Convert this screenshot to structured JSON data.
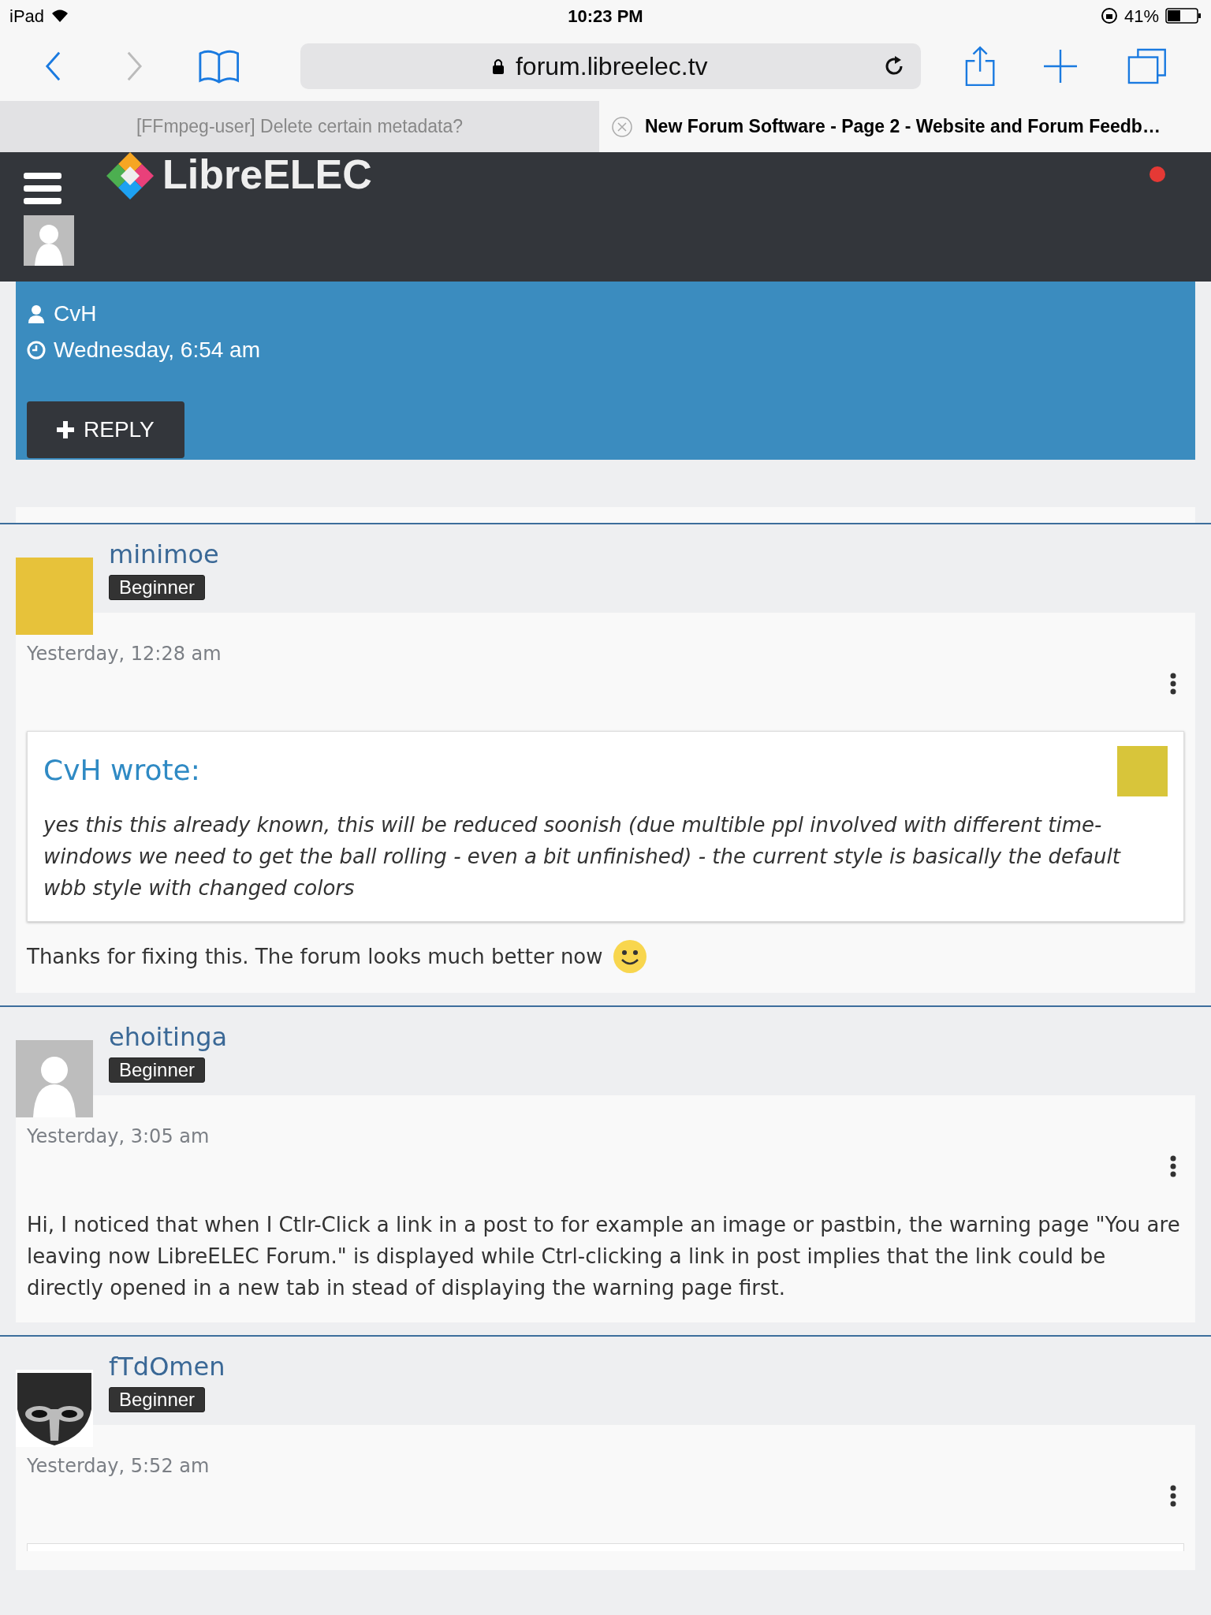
{
  "status_bar": {
    "device": "iPad",
    "time": "10:23 PM",
    "battery": "41%"
  },
  "browser": {
    "url": "forum.libreelec.tv",
    "tabs": [
      {
        "title": "[FFmpeg-user] Delete certain metadata?",
        "selected": false
      },
      {
        "title": "New Forum Software - Page 2 - Website and Forum Feedb…",
        "selected": true
      }
    ]
  },
  "site_header": {
    "logo": "LibreELEC",
    "notification": true
  },
  "thread": {
    "author": "CvH",
    "date": "Wednesday, 6:54 am",
    "reply_button": "REPLY"
  },
  "posts": [
    {
      "author": "minimoe",
      "rank": "Beginner",
      "avatar": {
        "kind": "photo"
      },
      "time": "Yesterday, 12:28 am",
      "quote": {
        "title": "CvH wrote:",
        "text": "yes this this already known, this will be reduced soonish (due multible ppl involved with different time-windows we need to get the ball rolling - even a bit unfinished) - the current style is basically the default wbb style with changed colors"
      },
      "body": "Thanks for fixing this. The forum looks much better now",
      "smiley": true
    },
    {
      "author": "ehoitinga",
      "rank": "Beginner",
      "avatar": {
        "kind": "default"
      },
      "time": "Yesterday, 3:05 am",
      "body": "Hi, I noticed that when I Ctlr-Click a link in a post to for example an image or pastbin, the warning page \"You are leaving now LibreELEC Forum.\" is displayed while Ctrl-clicking a link in post implies that the link could be directly opened in a new tab in stead of displaying the warning page first.",
      "smiley": false
    },
    {
      "author": "fTdOmen",
      "rank": "Beginner",
      "avatar": {
        "kind": "emblem"
      },
      "time": "Yesterday, 5:52 am",
      "quote_start": true,
      "smiley": false
    }
  ]
}
